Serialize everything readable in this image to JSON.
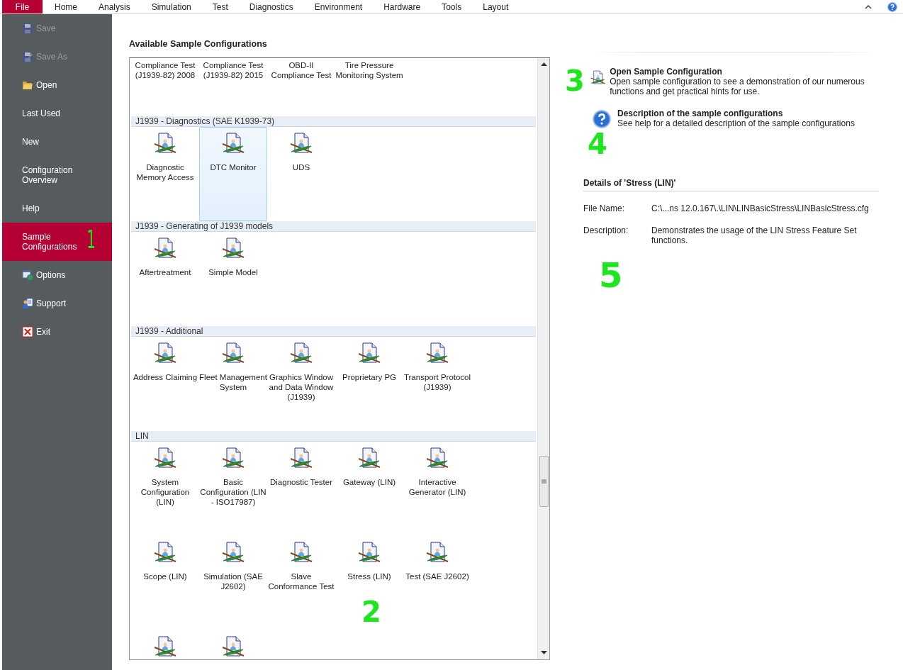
{
  "menu_bar": {
    "items": [
      {
        "label": "File",
        "selected": true
      },
      {
        "label": "Home",
        "selected": false
      },
      {
        "label": "Analysis",
        "selected": false
      },
      {
        "label": "Simulation",
        "selected": false
      },
      {
        "label": "Test",
        "selected": false
      },
      {
        "label": "Diagnostics",
        "selected": false
      },
      {
        "label": "Environment",
        "selected": false
      },
      {
        "label": "Hardware",
        "selected": false
      },
      {
        "label": "Tools",
        "selected": false
      },
      {
        "label": "Layout",
        "selected": false
      }
    ]
  },
  "sidebar": {
    "items": [
      {
        "label": "Save",
        "kind": "save",
        "disabled": true,
        "selected": false
      },
      {
        "label": "Save As",
        "kind": "save-as",
        "disabled": true,
        "selected": false
      },
      {
        "label": "Open",
        "kind": "open",
        "disabled": false,
        "selected": false
      },
      {
        "label": "Last Used",
        "disabled": false,
        "selected": false
      },
      {
        "label": "New",
        "disabled": false,
        "selected": false
      },
      {
        "label": "Configuration Overview",
        "disabled": false,
        "selected": false
      },
      {
        "label": "Help",
        "disabled": false,
        "selected": false
      },
      {
        "label": "Sample Configurations",
        "disabled": false,
        "selected": true,
        "annotation": "1"
      },
      {
        "label": "Options",
        "kind": "options",
        "disabled": false,
        "selected": false
      },
      {
        "label": "Support",
        "kind": "support",
        "disabled": false,
        "selected": false
      },
      {
        "label": "Exit",
        "kind": "exit",
        "disabled": false,
        "selected": false
      }
    ]
  },
  "samples": {
    "title": "Available Sample Configurations",
    "groups": [
      {
        "tiles": [
          {
            "kind": "text",
            "label": "Compliance Test (J1939-82) 2008",
            "selected": false
          },
          {
            "kind": "text",
            "label": "Compliance Test (J1939-82) 2015",
            "selected": false
          },
          {
            "kind": "text",
            "label": "OBD-II Compliance Test",
            "selected": false
          },
          {
            "kind": "text",
            "label": "Tire Pressure Monitoring System",
            "selected": false
          }
        ]
      },
      {
        "title": "J1939 - Diagnostics (SAE K1939-73)",
        "tiles": [
          {
            "kind": "full",
            "label": "Diagnostic Memory Access",
            "selected": false
          },
          {
            "kind": "full",
            "label": "DTC Monitor",
            "selected": true
          },
          {
            "kind": "full",
            "label": "UDS",
            "selected": false
          }
        ]
      },
      {
        "title": "J1939 - Generating of J1939 models",
        "tiles": [
          {
            "kind": "full",
            "label": "Aftertreatment",
            "selected": false
          },
          {
            "kind": "full",
            "label": "Simple Model",
            "selected": false
          }
        ]
      },
      {
        "title": "J1939 - Additional",
        "tiles": [
          {
            "kind": "full",
            "label": "Address Claiming",
            "selected": false
          },
          {
            "kind": "full",
            "label": "Fleet Management System",
            "selected": false
          },
          {
            "kind": "full",
            "label": "Graphics Window and Data Window (J1939)",
            "selected": false
          },
          {
            "kind": "full",
            "label": "Proprietary PG",
            "selected": false
          },
          {
            "kind": "full",
            "label": "Transport Protocol (J1939)",
            "selected": false
          }
        ]
      },
      {
        "title": "LIN",
        "tiles": [
          {
            "kind": "full",
            "label": "System Configuration (LIN)",
            "selected": false
          },
          {
            "kind": "full",
            "label": "Basic Configuration (LIN - ISO17987)",
            "selected": false
          },
          {
            "kind": "full",
            "label": "Diagnostic Tester",
            "selected": false
          },
          {
            "kind": "full",
            "label": "Gateway (LIN)",
            "selected": false
          },
          {
            "kind": "full",
            "label": "Interactive Generator (LIN)",
            "selected": false
          },
          {
            "kind": "full",
            "label": "Scope (LIN)",
            "selected": false
          },
          {
            "kind": "full",
            "label": "Simulation (SAE J2602)",
            "selected": false
          },
          {
            "kind": "full",
            "label": "Slave Conformance Test",
            "selected": false
          },
          {
            "kind": "full",
            "label": "Stress (LIN)",
            "selected": false,
            "annotation": "2"
          },
          {
            "kind": "full",
            "label": "Test (SAE J2602)",
            "selected": false
          },
          {
            "kind": "icon",
            "selected": false
          },
          {
            "kind": "icon",
            "selected": false
          }
        ]
      }
    ]
  },
  "actions": [
    {
      "kind": "open",
      "title": "Open Sample Configuration",
      "text": "Open sample configuration to see a demonstration of our numerous functions and get practical hints for use.",
      "annotation": "3"
    },
    {
      "kind": "help",
      "title": "Description of the sample configurations",
      "text": "See help for a detailed description of the sample configurations",
      "annotation": "4"
    }
  ],
  "details": {
    "title": "Details of 'Stress (LIN)'",
    "rows": [
      {
        "label": "File Name:",
        "value": "C:\\...ns 12.0.167\\.\\LIN\\LINBasicStress\\LINBasicStress.cfg"
      },
      {
        "label": "Description:",
        "value": "Demonstrates the usage of the LIN Stress Feature Set functions."
      }
    ],
    "annotation": "5"
  }
}
